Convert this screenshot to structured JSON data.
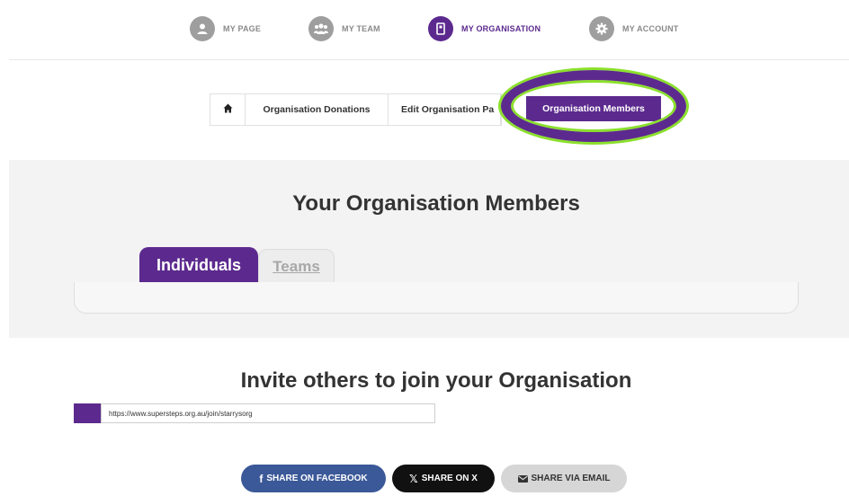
{
  "topnav": {
    "items": [
      {
        "label": "MY PAGE",
        "icon": "person-icon"
      },
      {
        "label": "MY TEAM",
        "icon": "team-icon"
      },
      {
        "label": "MY ORGANISATION",
        "icon": "organisation-icon",
        "active": true
      },
      {
        "label": "MY ACCOUNT",
        "icon": "gear-icon"
      }
    ]
  },
  "breadcrumb": {
    "items": [
      {
        "label": "",
        "icon": "home-icon"
      },
      {
        "label": "Organisation Donations"
      },
      {
        "label": "Edit Organisation Pa"
      },
      {
        "label": "Organisation Members",
        "active": true
      }
    ]
  },
  "members": {
    "title": "Your Organisation Members",
    "tabs": [
      {
        "label": "Individuals",
        "active": true
      },
      {
        "label": "Teams",
        "active": false
      }
    ]
  },
  "invite": {
    "title": "Invite others to join your Organisation",
    "link": "https://www.supersteps.org.au/join/starrysorg"
  },
  "share": {
    "facebook": "SHARE ON FACEBOOK",
    "x": "SHARE ON X",
    "email": "SHARE VIA EMAIL"
  },
  "colors": {
    "brand_purple": "#5c2a8e",
    "highlight_green": "#8be02b",
    "facebook_blue": "#3b5998",
    "x_black": "#111111",
    "muted_grey": "#9e9e9e"
  }
}
